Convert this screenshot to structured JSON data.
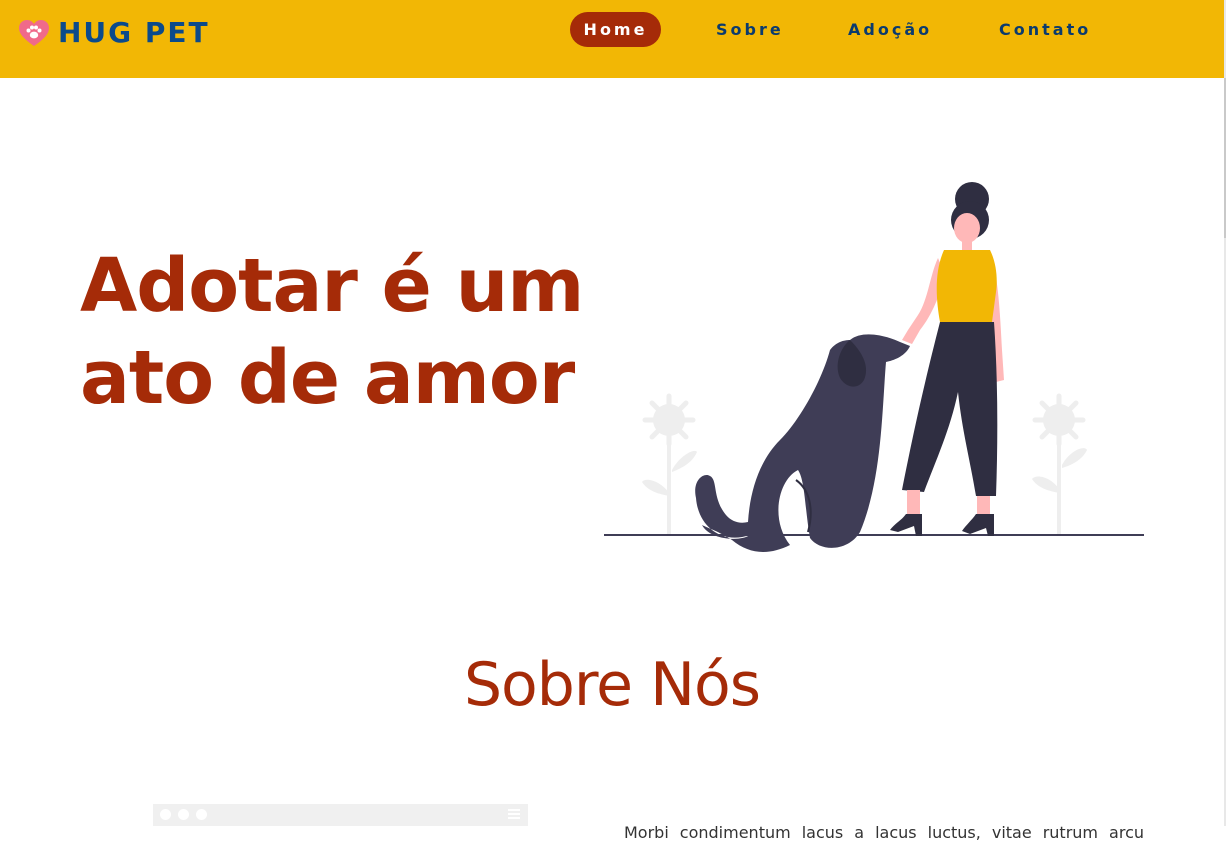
{
  "header": {
    "brand": "HUG PET",
    "nav": [
      {
        "label": "Home",
        "active": true
      },
      {
        "label": "Sobre",
        "active": false
      },
      {
        "label": "Adoção",
        "active": false
      },
      {
        "label": "Contato",
        "active": false
      }
    ]
  },
  "hero": {
    "title_line1": "Adotar é um",
    "title_line2": "ato de amor"
  },
  "about": {
    "title": "Sobre Nós",
    "text": "Morbi condimentum lacus a lacus luctus, vitae rutrum arcu"
  },
  "colors": {
    "header_bg": "#f2b705",
    "brand": "#0b4a8b",
    "accent": "#a52b08",
    "dog": "#3f3d56",
    "pants": "#2f2e41"
  },
  "icons": {
    "logo": "heart-paw-icon",
    "browser_menu": "hamburger-menu-icon"
  }
}
